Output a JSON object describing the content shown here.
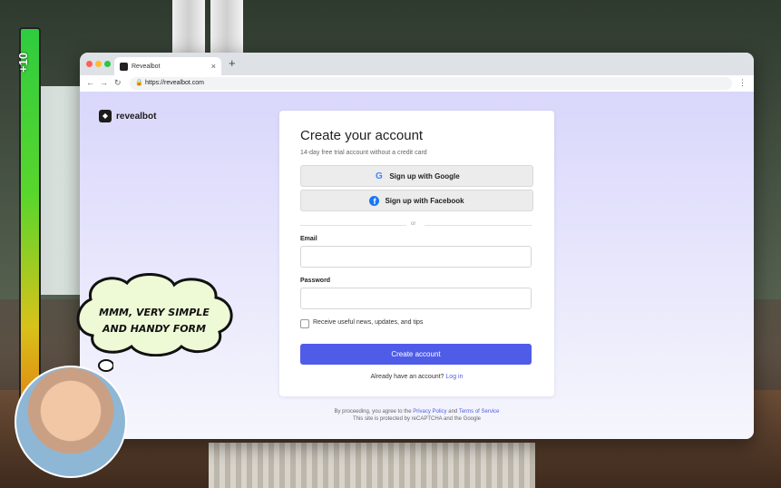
{
  "overlay": {
    "score": "+10",
    "speech": [
      "MMM, VERY SIMPLE",
      "AND HANDY FORM"
    ]
  },
  "browser": {
    "tab_title": "Revealbot",
    "url": "https://revealbot.com",
    "nav_icons": [
      "back-arrow",
      "forward-arrow",
      "reload"
    ]
  },
  "page": {
    "logo": "revealbot",
    "title": "Create your account",
    "subtitle": "14-day free trial account without a credit card",
    "google_button": "Sign up with Google",
    "facebook_button": "Sign up with Facebook",
    "divider": "or",
    "email_label": "Email",
    "email_value": "",
    "password_label": "Password",
    "password_value": "",
    "newsletter_label": "Receive useful news, updates, and tips",
    "newsletter_checked": false,
    "submit": "Create account",
    "login_prompt": "Already have an account?",
    "login_link": "Log in",
    "legal_prefix": "By proceeding, you agree to the",
    "privacy": "Privacy Policy",
    "and": "and",
    "terms": "Terms of Service",
    "recaptcha": "This site is protected by reCAPTCHA and the Google"
  },
  "colors": {
    "primary": "#4f5ce8",
    "page_bg_top": "#d9d7fb",
    "facebook": "#1877f2"
  }
}
